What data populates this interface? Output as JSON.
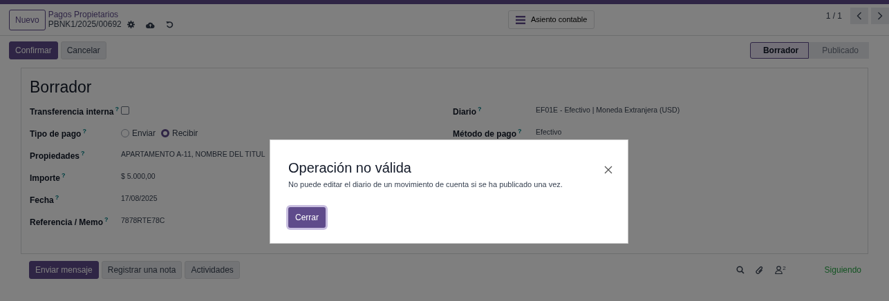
{
  "control_panel": {
    "new_button": "Nuevo",
    "breadcrumb": "Pagos Propietarios",
    "record_name": "PBNK1/2025/00692",
    "smart_button": "Asiento contable",
    "pager": "1 / 1"
  },
  "action_buttons": [
    {
      "label": "Confirmar",
      "kind": "primary"
    },
    {
      "label": "Cancelar",
      "kind": "secondary"
    }
  ],
  "status_steps": [
    {
      "label": "Borrador",
      "selected": true
    },
    {
      "label": "Publicado",
      "selected": false
    }
  ],
  "form": {
    "title": "Borrador",
    "left_fields": [
      {
        "label": "Transferencia interna",
        "help": "?",
        "kind": "checkbox",
        "checked": false
      },
      {
        "label": "Tipo de pago",
        "help": "?",
        "kind": "radio",
        "options": [
          {
            "label": "Enviar",
            "selected": false
          },
          {
            "label": "Recibir",
            "selected": true
          }
        ]
      },
      {
        "label": "Propiedades",
        "help": "?",
        "kind": "text",
        "value": "APARTAMENTO A-11, NOMBRE DEL TITUL"
      },
      {
        "label": "Importe",
        "help": "?",
        "kind": "text",
        "value": "$ 5.000,00"
      },
      {
        "label": "Fecha",
        "help": "?",
        "kind": "text",
        "value": "17/08/2025"
      },
      {
        "label": "Referencia / Memo",
        "help": "?",
        "kind": "text",
        "value": "7878RTE78C"
      }
    ],
    "right_fields": [
      {
        "label": "Diario",
        "help": "?",
        "kind": "text",
        "value": "EF01E - Efectivo | Moneda Extranjera (USD)"
      },
      {
        "label": "Método de pago",
        "help": "?",
        "kind": "text",
        "value": "Efectivo"
      }
    ]
  },
  "chatter": {
    "buttons": [
      {
        "label": "Enviar mensaje",
        "kind": "primary"
      },
      {
        "label": "Registrar una nota",
        "kind": "secondary"
      },
      {
        "label": "Actividades",
        "kind": "secondary"
      }
    ],
    "followers_count": "2",
    "follow_status": "Siguiendo"
  },
  "dialog": {
    "title": "Operación no válida",
    "message": "No puede editar el diario de un movimiento de cuenta si se ha publicado una vez.",
    "button": "Cerrar"
  }
}
